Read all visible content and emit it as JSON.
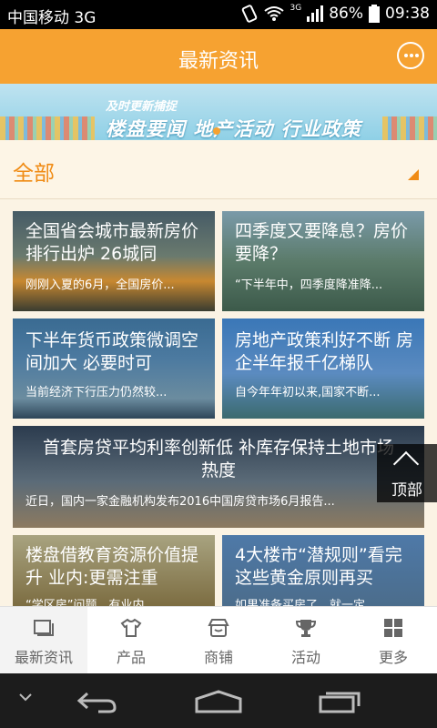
{
  "status_bar": {
    "carrier": "中国移动 3G",
    "network": "3G",
    "battery": "86%",
    "time": "09:38"
  },
  "app_bar": {
    "title": "最新资讯",
    "message_icon": "chat-bubble-icon"
  },
  "banner": {
    "tagline": "及时更新捕捉",
    "headline": "楼盘要闻  地产活动  行业政策"
  },
  "filter": {
    "label": "全部"
  },
  "articles": [
    {
      "title": "全国省会城市最新房价排行出炉 26城同",
      "summary": "刚刚入夏的6月，全国房价..."
    },
    {
      "title": "四季度又要降息？房价要降？",
      "summary": "“下半年中，四季度降准降..."
    },
    {
      "title": "下半年货币政策微调空间加大 必要时可",
      "summary": "当前经济下行压力仍然较..."
    },
    {
      "title": "房地产政策利好不断 房企半年报千亿梯队",
      "summary": "自今年年初以来,国家不断..."
    },
    {
      "title": "首套房贷平均利率创新低 补库存保持土地市场热度",
      "summary": "近日，国内一家金融机构发布2016中国房贷市场6月报告..."
    },
    {
      "title": "楼盘借教育资源价值提升 业内:更需注重",
      "summary": "“学区房”问题，有业内..."
    },
    {
      "title": "4大楼市“潜规则”看完这些黄金原则再买",
      "summary": "如果准备买房了，就一定..."
    }
  ],
  "back_to_top": {
    "label": "顶部"
  },
  "tabs": [
    {
      "label": "最新资讯",
      "icon": "news-icon"
    },
    {
      "label": "产品",
      "icon": "shirt-icon"
    },
    {
      "label": "商铺",
      "icon": "shop-icon"
    },
    {
      "label": "活动",
      "icon": "trophy-icon"
    },
    {
      "label": "更多",
      "icon": "grid-icon"
    }
  ],
  "colors": {
    "accent": "#f6a231",
    "filter_text": "#f08b14"
  }
}
